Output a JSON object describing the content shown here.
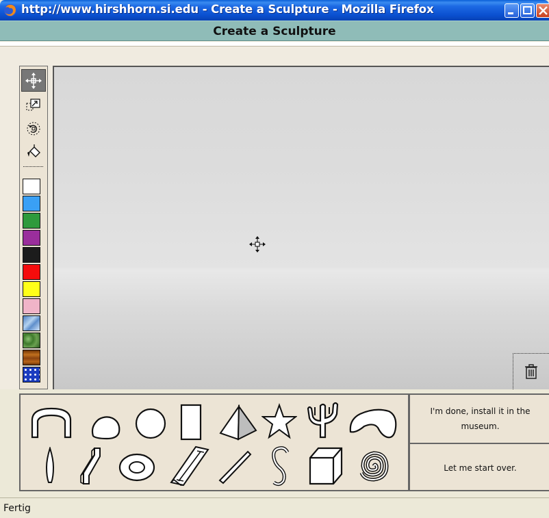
{
  "window": {
    "title": "http://www.hirshhorn.si.edu - Create a Sculpture - Mozilla Firefox"
  },
  "header": {
    "title": "Create a Sculpture"
  },
  "toolbar": {
    "tools": [
      {
        "name": "move-tool",
        "icon": "move-arrows-icon",
        "active": true
      },
      {
        "name": "resize-tool",
        "icon": "resize-icon",
        "active": false
      },
      {
        "name": "rotate-tool",
        "icon": "rotate-icon",
        "active": false
      },
      {
        "name": "paint-tool",
        "icon": "paint-bucket-icon",
        "active": false
      }
    ],
    "colors": [
      {
        "name": "white",
        "value": "#ffffff"
      },
      {
        "name": "blue",
        "value": "#3aa0f5"
      },
      {
        "name": "green",
        "value": "#2e9a3c"
      },
      {
        "name": "purple",
        "value": "#9a2e9c"
      },
      {
        "name": "black",
        "value": "#1c1c1c"
      },
      {
        "name": "red",
        "value": "#f50c0c"
      },
      {
        "name": "yellow",
        "value": "#ffff18"
      },
      {
        "name": "pink",
        "value": "#f0b4c8"
      },
      {
        "name": "sky-texture",
        "value": "#6e9ccf"
      },
      {
        "name": "grass-texture",
        "value": "#4e8a3c"
      },
      {
        "name": "wood-texture",
        "value": "#9b5214"
      },
      {
        "name": "polka-dot-texture",
        "value": "#1b3cc0"
      }
    ]
  },
  "palette": {
    "shapes": [
      "arch",
      "pebble",
      "sphere",
      "slab",
      "pyramid",
      "star",
      "cactus",
      "blob",
      "flame",
      "bent-bar",
      "ring",
      "i-beam",
      "rod",
      "s-hook",
      "cube",
      "spiral"
    ]
  },
  "actions": {
    "done_label": "I'm done, install it in the museum.",
    "start_over_label": "Let me start over."
  },
  "status": {
    "text": "Fertig"
  }
}
